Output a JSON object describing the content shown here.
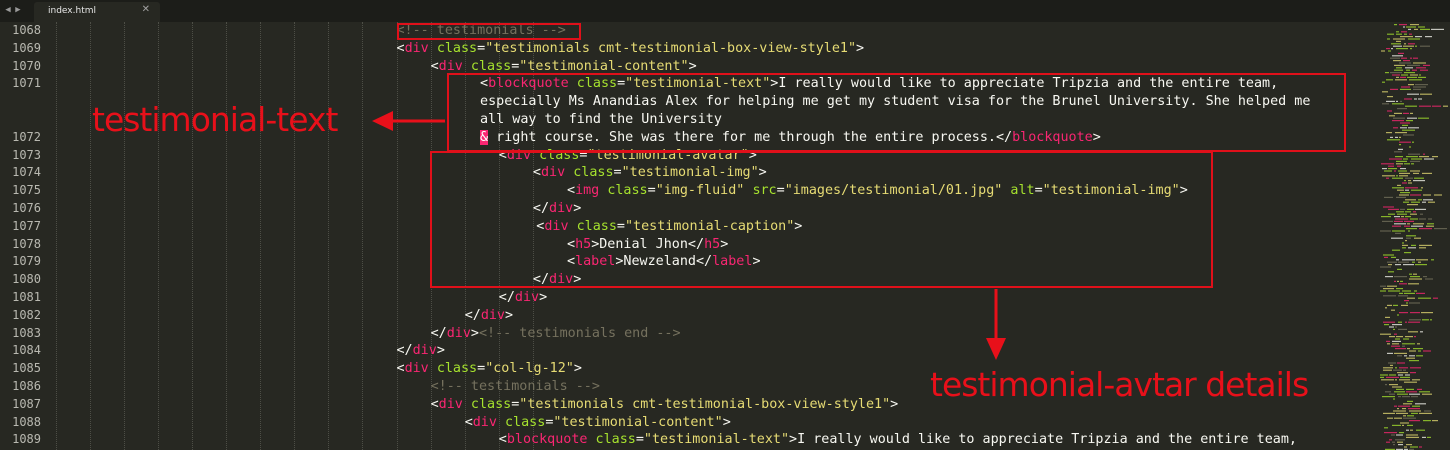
{
  "tabbar": {
    "nav_left": "◀",
    "nav_right": "▶",
    "tab_label": "index.html",
    "tab_close": "✕"
  },
  "line_numbers": [
    "1068",
    "1069",
    "1070",
    "1071",
    "",
    "",
    "1072",
    "1073",
    "1074",
    "1075",
    "1076",
    "1077",
    "1078",
    "1079",
    "1080",
    "1081",
    "1082",
    "1083",
    "1084",
    "1085",
    "1086",
    "1087",
    "1088",
    "1089"
  ],
  "code_lines": [
    {
      "indent": 10,
      "tokens": [
        {
          "c": "cm",
          "t": "<!-- testimonials -->"
        }
      ]
    },
    {
      "indent": 10,
      "tokens": [
        {
          "c": "tx",
          "t": "<"
        },
        {
          "c": "tg",
          "t": "div"
        },
        {
          "c": "tx",
          "t": " "
        },
        {
          "c": "at",
          "t": "class"
        },
        {
          "c": "tx",
          "t": "="
        },
        {
          "c": "st",
          "t": "\"testimonials cmt-testimonial-box-view-style1\""
        },
        {
          "c": "tx",
          "t": ">"
        }
      ]
    },
    {
      "indent": 11,
      "tokens": [
        {
          "c": "tx",
          "t": "<"
        },
        {
          "c": "tg",
          "t": "div"
        },
        {
          "c": "tx",
          "t": " "
        },
        {
          "c": "at",
          "t": "class"
        },
        {
          "c": "tx",
          "t": "="
        },
        {
          "c": "st",
          "t": "\"testimonial-content\""
        },
        {
          "c": "tx",
          "t": ">"
        }
      ]
    },
    {
      "indent": 12.45,
      "tokens": [
        {
          "c": "tx",
          "t": "<"
        },
        {
          "c": "tg",
          "t": "blockquote"
        },
        {
          "c": "tx",
          "t": " "
        },
        {
          "c": "at",
          "t": "class"
        },
        {
          "c": "tx",
          "t": "="
        },
        {
          "c": "st",
          "t": "\"testimonial-text\""
        },
        {
          "c": "tx",
          "t": ">I really would like to appreciate Tripzia and the entire team,"
        }
      ]
    },
    {
      "indent": 12.45,
      "tokens": [
        {
          "c": "tx",
          "t": "especially Ms Anandias Alex for helping me get my student visa for the Brunel University. She helped me"
        }
      ]
    },
    {
      "indent": 12.45,
      "tokens": [
        {
          "c": "tx",
          "t": "all way to find the University"
        }
      ]
    },
    {
      "indent": 12.45,
      "tokens": [
        {
          "c": "amp",
          "t": "&"
        },
        {
          "c": "tx",
          "t": " right course. She was there for me through the entire process.</"
        },
        {
          "c": "tg",
          "t": "blockquote"
        },
        {
          "c": "tx",
          "t": ">"
        }
      ]
    },
    {
      "indent": 13,
      "tokens": [
        {
          "c": "tx",
          "t": "<"
        },
        {
          "c": "tg",
          "t": "div"
        },
        {
          "c": "tx",
          "t": " "
        },
        {
          "c": "at",
          "t": "class"
        },
        {
          "c": "tx",
          "t": "="
        },
        {
          "c": "st",
          "t": "\"testimonial-avatar\""
        },
        {
          "c": "tx",
          "t": ">"
        }
      ]
    },
    {
      "indent": 14,
      "tokens": [
        {
          "c": "tx",
          "t": "<"
        },
        {
          "c": "tg",
          "t": "div"
        },
        {
          "c": "tx",
          "t": " "
        },
        {
          "c": "at",
          "t": "class"
        },
        {
          "c": "tx",
          "t": "="
        },
        {
          "c": "st",
          "t": "\"testimonial-img\""
        },
        {
          "c": "tx",
          "t": ">"
        }
      ]
    },
    {
      "indent": 15,
      "tokens": [
        {
          "c": "tx",
          "t": "<"
        },
        {
          "c": "tg",
          "t": "img"
        },
        {
          "c": "tx",
          "t": " "
        },
        {
          "c": "at",
          "t": "class"
        },
        {
          "c": "tx",
          "t": "="
        },
        {
          "c": "st",
          "t": "\"img-fluid\""
        },
        {
          "c": "tx",
          "t": " "
        },
        {
          "c": "at",
          "t": "src"
        },
        {
          "c": "tx",
          "t": "="
        },
        {
          "c": "st",
          "t": "\"images/testimonial/01.jpg\""
        },
        {
          "c": "tx",
          "t": " "
        },
        {
          "c": "at",
          "t": "alt"
        },
        {
          "c": "tx",
          "t": "="
        },
        {
          "c": "st",
          "t": "\"testimonial-img\""
        },
        {
          "c": "tx",
          "t": ">"
        }
      ]
    },
    {
      "indent": 14,
      "tokens": [
        {
          "c": "tx",
          "t": "</"
        },
        {
          "c": "tg",
          "t": "div"
        },
        {
          "c": "tx",
          "t": ">"
        }
      ]
    },
    {
      "indent": 14.1,
      "tokens": [
        {
          "c": "tx",
          "t": "<"
        },
        {
          "c": "tg",
          "t": "div"
        },
        {
          "c": "tx",
          "t": " "
        },
        {
          "c": "at",
          "t": "class"
        },
        {
          "c": "tx",
          "t": "="
        },
        {
          "c": "st",
          "t": "\"testimonial-caption\""
        },
        {
          "c": "tx",
          "t": ">"
        }
      ]
    },
    {
      "indent": 15,
      "tokens": [
        {
          "c": "tx",
          "t": "<"
        },
        {
          "c": "tg",
          "t": "h5"
        },
        {
          "c": "tx",
          "t": ">Denial Jhon</"
        },
        {
          "c": "tg",
          "t": "h5"
        },
        {
          "c": "tx",
          "t": ">"
        }
      ]
    },
    {
      "indent": 15,
      "tokens": [
        {
          "c": "tx",
          "t": "<"
        },
        {
          "c": "tg",
          "t": "label"
        },
        {
          "c": "tx",
          "t": ">Newzeland</"
        },
        {
          "c": "tg",
          "t": "label"
        },
        {
          "c": "tx",
          "t": ">"
        }
      ]
    },
    {
      "indent": 14,
      "tokens": [
        {
          "c": "tx",
          "t": "</"
        },
        {
          "c": "tg",
          "t": "div"
        },
        {
          "c": "tx",
          "t": ">"
        }
      ]
    },
    {
      "indent": 13,
      "tokens": [
        {
          "c": "tx",
          "t": "</"
        },
        {
          "c": "tg",
          "t": "div"
        },
        {
          "c": "tx",
          "t": ">"
        }
      ]
    },
    {
      "indent": 12,
      "tokens": [
        {
          "c": "tx",
          "t": "</"
        },
        {
          "c": "tg",
          "t": "div"
        },
        {
          "c": "tx",
          "t": ">"
        }
      ]
    },
    {
      "indent": 11,
      "tokens": [
        {
          "c": "tx",
          "t": "</"
        },
        {
          "c": "tg",
          "t": "div"
        },
        {
          "c": "tx",
          "t": ">"
        },
        {
          "c": "cm",
          "t": "<!-- testimonials end -->"
        }
      ]
    },
    {
      "indent": 10,
      "tokens": [
        {
          "c": "tx",
          "t": "</"
        },
        {
          "c": "tg",
          "t": "div"
        },
        {
          "c": "tx",
          "t": ">"
        }
      ]
    },
    {
      "indent": 10,
      "tokens": [
        {
          "c": "tx",
          "t": "<"
        },
        {
          "c": "tg",
          "t": "div"
        },
        {
          "c": "tx",
          "t": " "
        },
        {
          "c": "at",
          "t": "class"
        },
        {
          "c": "tx",
          "t": "="
        },
        {
          "c": "st",
          "t": "\"col-lg-12\""
        },
        {
          "c": "tx",
          "t": ">"
        }
      ]
    },
    {
      "indent": 11,
      "tokens": [
        {
          "c": "cm",
          "t": "<!-- testimonials -->"
        }
      ]
    },
    {
      "indent": 11,
      "tokens": [
        {
          "c": "tx",
          "t": "<"
        },
        {
          "c": "tg",
          "t": "div"
        },
        {
          "c": "tx",
          "t": " "
        },
        {
          "c": "at",
          "t": "class"
        },
        {
          "c": "tx",
          "t": "="
        },
        {
          "c": "st",
          "t": "\"testimonials cmt-testimonial-box-view-style1\""
        },
        {
          "c": "tx",
          "t": ">"
        }
      ]
    },
    {
      "indent": 12,
      "tokens": [
        {
          "c": "tx",
          "t": "<"
        },
        {
          "c": "tg",
          "t": "div"
        },
        {
          "c": "tx",
          "t": " "
        },
        {
          "c": "at",
          "t": "class"
        },
        {
          "c": "tx",
          "t": "="
        },
        {
          "c": "st",
          "t": "\"testimonial-content\""
        },
        {
          "c": "tx",
          "t": ">"
        }
      ]
    },
    {
      "indent": 13,
      "tokens": [
        {
          "c": "tx",
          "t": "<"
        },
        {
          "c": "tg",
          "t": "blockquote"
        },
        {
          "c": "tx",
          "t": " "
        },
        {
          "c": "at",
          "t": "class"
        },
        {
          "c": "tx",
          "t": "="
        },
        {
          "c": "st",
          "t": "\"testimonial-text\""
        },
        {
          "c": "tx",
          "t": ">I really would like to appreciate Tripzia and the entire team,"
        }
      ]
    }
  ],
  "annotations": {
    "text_label": "testimonial-text",
    "avatar_label": "testimonial-avtar details",
    "color": "#e8101a"
  },
  "theme": {
    "background": "#272822",
    "tag": "#f92672",
    "attribute": "#a6e22e",
    "string": "#e6db74",
    "comment": "#75715e",
    "text": "#f8f8f2"
  }
}
